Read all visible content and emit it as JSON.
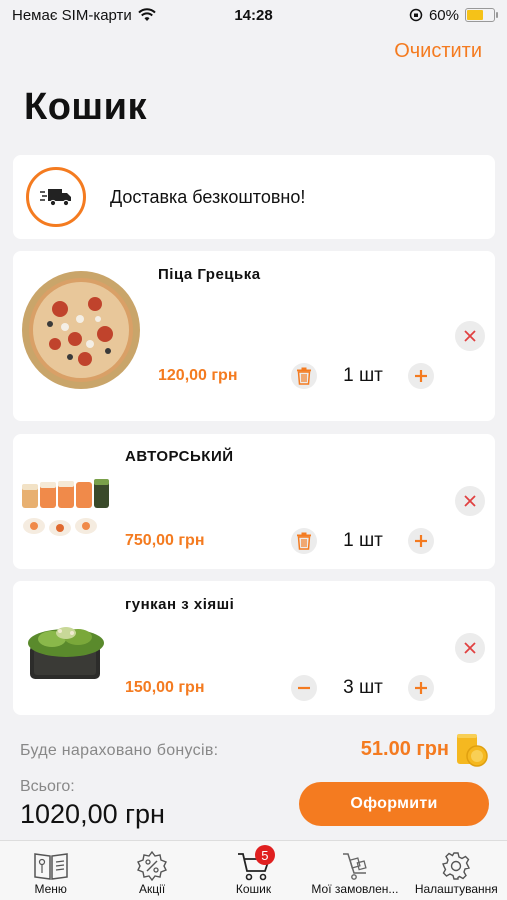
{
  "status_bar": {
    "carrier": "Немає SIM-карти",
    "time": "14:28",
    "battery_percent": "60%",
    "battery_level": 0.6
  },
  "header": {
    "clear_label": "Очистити",
    "title": "Кошик"
  },
  "delivery": {
    "text": "Доставка безкоштовно!",
    "icon": "delivery-truck-icon"
  },
  "items": [
    {
      "name": "Піца Грецька",
      "price": "120,00 грн",
      "quantity": "1 шт",
      "image": "pizza"
    },
    {
      "name": "АВТОРСЬКИЙ",
      "price": "750,00 грн",
      "quantity": "1 шт",
      "image": "sushi-rolls"
    },
    {
      "name": "гункан з хіяші",
      "price": "150,00 грн",
      "quantity": "3 шт",
      "image": "gunkan"
    }
  ],
  "summary": {
    "bonus_label": "Буде нараховано бонусів:",
    "bonus_value": "51.00 грн",
    "total_label": "Всього:",
    "total_value": "1020,00 грн",
    "checkout_label": "Оформити"
  },
  "tabs": [
    {
      "label": "Меню",
      "icon": "menu-book-icon"
    },
    {
      "label": "Акції",
      "icon": "discount-badge-icon"
    },
    {
      "label": "Кошик",
      "icon": "cart-icon",
      "badge": "5"
    },
    {
      "label": "Мої замовлен...",
      "icon": "orders-cart-icon"
    },
    {
      "label": "Налаштування",
      "icon": "gear-icon"
    }
  ],
  "colors": {
    "accent": "#f47b20",
    "background": "#f2f2f4",
    "badge": "#e02020"
  }
}
